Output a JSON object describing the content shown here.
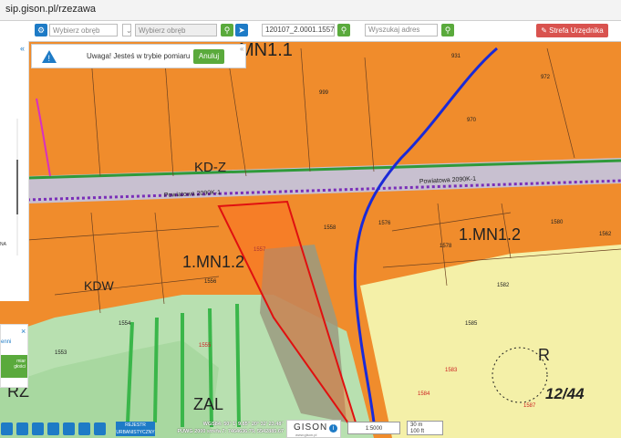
{
  "browser": {
    "url": "sip.gison.pl/rzezawa"
  },
  "toolbar": {
    "left_tab": "ennej",
    "precinct_placeholder_1": "Wybierz obręb",
    "precinct_placeholder_2": "Wybierz obręb",
    "parcel_value": "120107_2.0001.1557 B",
    "address_placeholder": "Wyszukaj adres",
    "official_zone_label": "Strefa Urzędnika"
  },
  "warning": {
    "text": "Uwaga! Jesteś w trybie pomiaru",
    "cancel_label": "Anuluj"
  },
  "left_panel": {
    "text_1": "NA",
    "text_2": "enni",
    "text_3": "miar",
    "text_4": "głości"
  },
  "map_labels": {
    "mn11": "MN1.1",
    "kdz": "KD-Z",
    "mn12a": "1.MN1.2",
    "mn12b": "1.MN1.2",
    "kdw": "KDW",
    "zal": "ZAL",
    "rz": "RZ",
    "r": "R",
    "plan": "12/44",
    "road1": "Powiatowa 2090K-1",
    "road2": "Powiatowa 2090K-1",
    "p1557": "1557",
    "p1554": "1554",
    "p1555": "1555",
    "p1556": "1556",
    "p1558": "1558",
    "p1582": "1582",
    "p1583": "1583",
    "p1584": "1584",
    "p1585": "1585",
    "p1587": "1587",
    "p1553": "1553",
    "p1578": "1578",
    "p1576": "1576",
    "p1580": "1580",
    "p999": "999",
    "p931": "931",
    "p972": "972",
    "p970": "970",
    "p1562": "1562"
  },
  "bottom_bar": {
    "register_label_1": "REJESTR",
    "register_label_2": "URBANISTYCZNY",
    "wgs84": "WGS84: 50° 1' 9.85\" 20° 32' 23.48\"",
    "puwg": "PUWG 2000 strefa 7: 7464636.79, 5542885.67",
    "brand": "GISON",
    "brand_url": "www.gison.pl",
    "scale_ratio": "1:5000",
    "scale_m": "30 m",
    "scale_ft": "100 ft"
  }
}
